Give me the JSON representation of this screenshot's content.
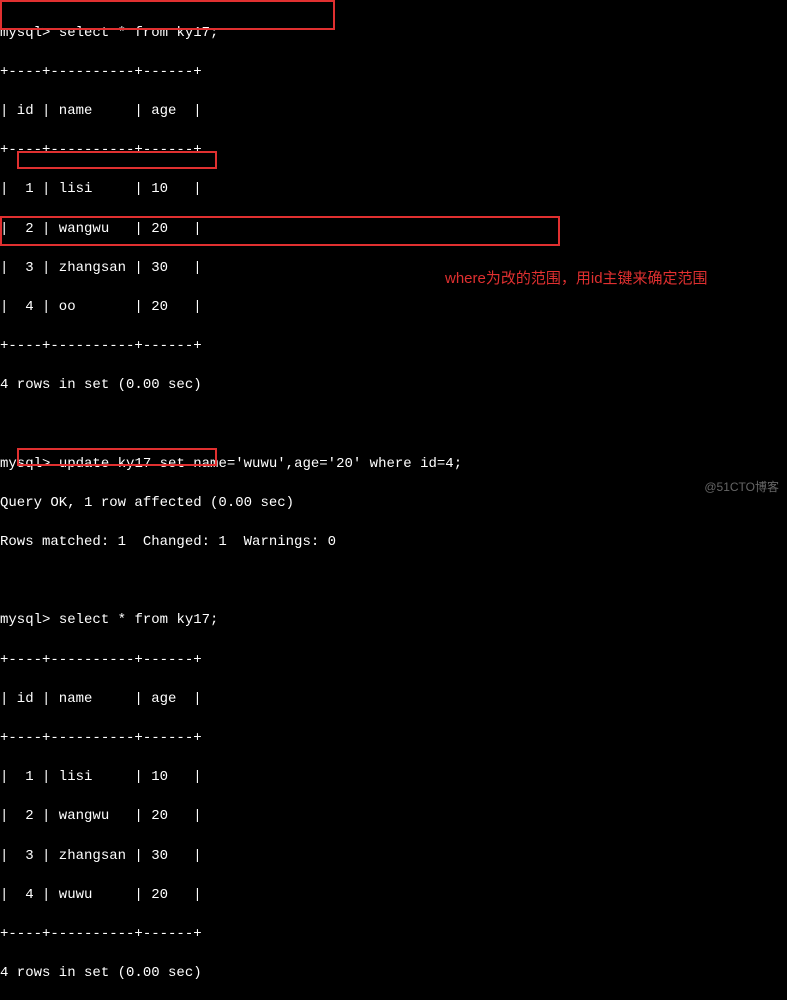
{
  "prompt": "mysql>",
  "queries": {
    "select": "select * from ky17;",
    "update": "update ky17 set name='wuwu',age='20' where id=4;"
  },
  "separator1": "+----+----------+------+",
  "headers": {
    "id": "| id | name     | age  |",
    "sep": "+----+----------+------+"
  },
  "rows1": [
    "|  1 | lisi     | 10   |",
    "|  2 | wangwu   | 20   |",
    "|  3 | zhangsan | 30   |",
    "|  4 | oo       | 20   |"
  ],
  "result1": "4 rows in set (0.00 sec)",
  "update_result1": "Query OK, 1 row affected (0.00 sec)",
  "update_result2": "Rows matched: 1  Changed: 1  Warnings: 0",
  "rows2": [
    "|  1 | lisi     | 10   |",
    "|  2 | wangwu   | 20   |",
    "|  3 | zhangsan | 30   |",
    "|  4 | wuwu     | 20   |"
  ],
  "result2": "4 rows in set (0.00 sec)",
  "annotation": "where为改的范围，用id主键来确定范围",
  "watermark": "@51CTO博客"
}
